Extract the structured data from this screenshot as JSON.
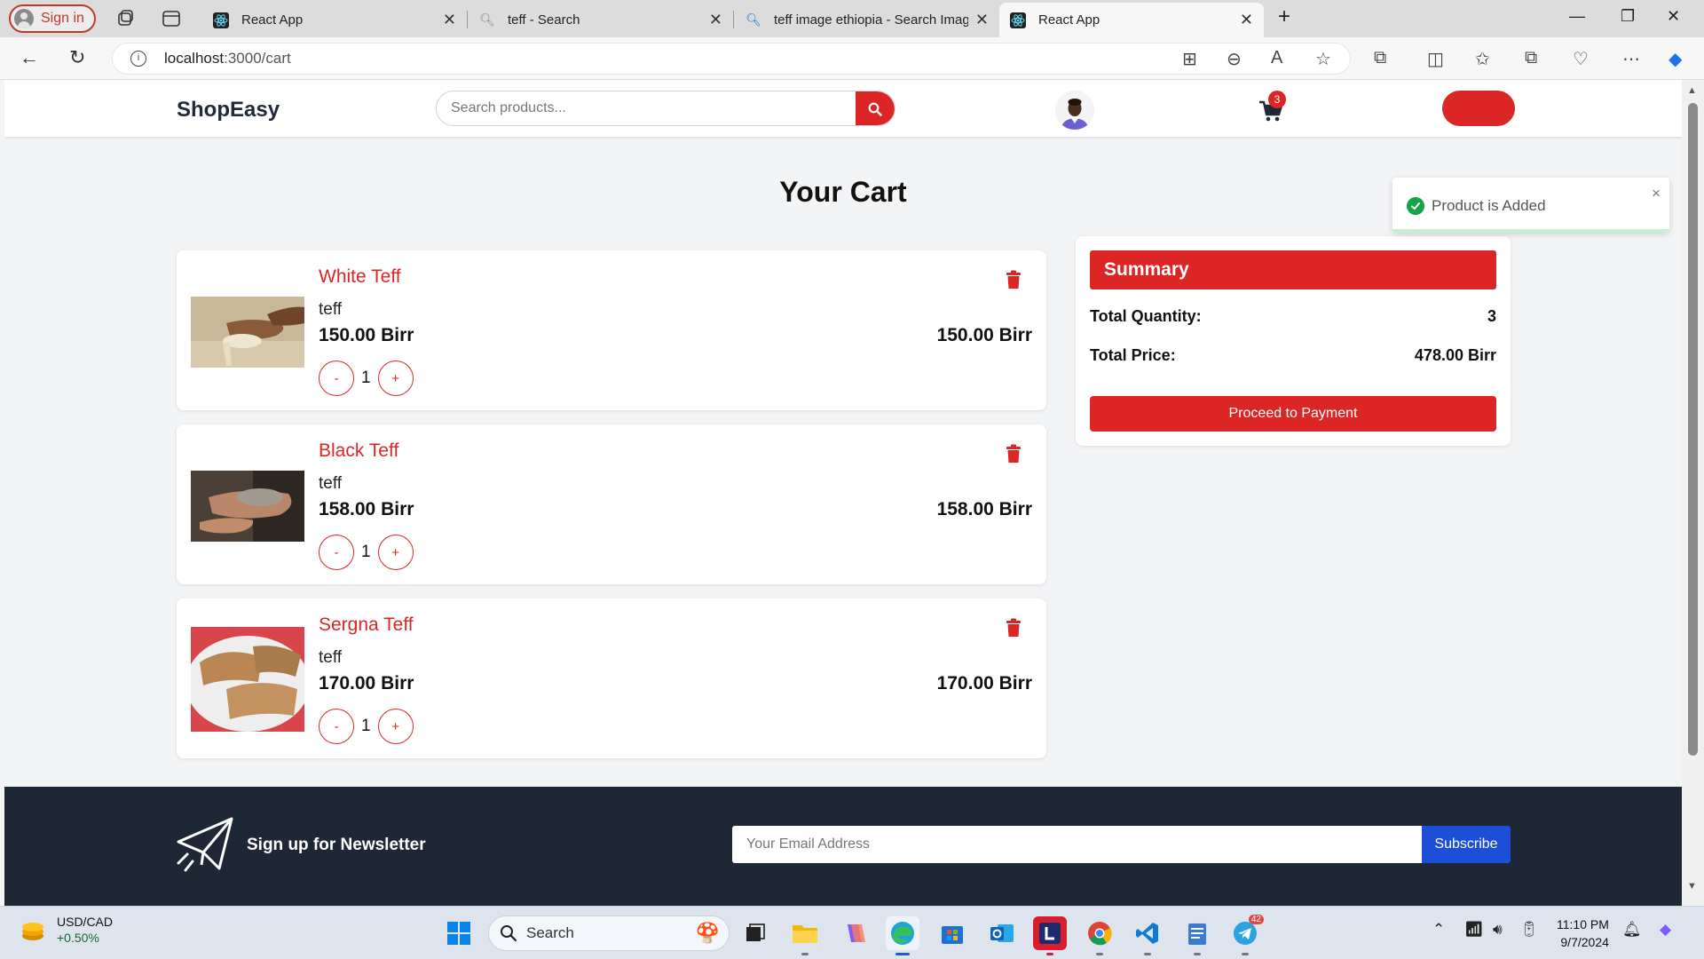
{
  "browser": {
    "signin_label": "Sign in",
    "tabs": [
      {
        "title": "React App",
        "icon": "react-icon"
      },
      {
        "title": "teff - Search",
        "icon": "search-icon"
      },
      {
        "title": "teff image ethiopia - Search Imag",
        "icon": "search-icon"
      },
      {
        "title": "React App",
        "icon": "react-icon"
      }
    ],
    "url_host": "localhost",
    "url_path": ":3000/cart"
  },
  "header": {
    "logo": "ShopEasy",
    "search_placeholder": "Search products...",
    "cart_count": "3",
    "accent": "#dc2626"
  },
  "cart": {
    "title": "Your Cart",
    "items": [
      {
        "name": "White Teff",
        "category": "teff",
        "price": "150.00 Birr",
        "line_total": "150.00 Birr",
        "qty": "1",
        "minus": "-",
        "plus": "+"
      },
      {
        "name": "Black Teff",
        "category": "teff",
        "price": "158.00 Birr",
        "line_total": "158.00 Birr",
        "qty": "1",
        "minus": "-",
        "plus": "+"
      },
      {
        "name": "Sergna Teff",
        "category": "teff",
        "price": "170.00 Birr",
        "line_total": "170.00 Birr",
        "qty": "1",
        "minus": "-",
        "plus": "+"
      }
    ]
  },
  "summary": {
    "title": "Summary",
    "total_quantity_label": "Total Quantity:",
    "total_quantity": "3",
    "total_price_label": "Total Price:",
    "total_price": "478.00 Birr",
    "pay_label": "Proceed to Payment"
  },
  "footer": {
    "newsletter_title": "Sign up for Newsletter",
    "email_placeholder": "Your Email Address",
    "subscribe_label": "Subscribe"
  },
  "toast": {
    "message": "Product is Added",
    "close": "×"
  },
  "taskbar": {
    "ticker_symbol": "USD/CAD",
    "ticker_change": "+0.50%",
    "search_label": "Search",
    "time": "11:10 PM",
    "date": "9/7/2024",
    "telegram_badge": "42"
  }
}
